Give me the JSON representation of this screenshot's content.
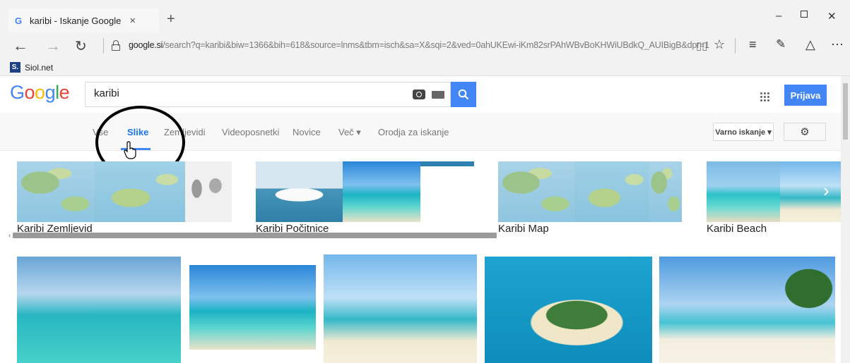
{
  "browser": {
    "tab_title": "karibi - Iskanje Google",
    "tab_close": "×",
    "new_tab": "+",
    "url_host": "google.si",
    "url_rest": "/search?q=karibi&biw=1366&bih=618&source=lnms&tbm=isch&sa=X&sqi=2&ved=0ahUKEwi-iKm82srPAhWBvBoKHWiUBdkQ_AUIBigB&dpr=1",
    "favorites": [
      {
        "label": "Siol.net",
        "icon_text": "S."
      }
    ]
  },
  "google": {
    "logo_letters": [
      {
        "ch": "G",
        "color": "#4285f4"
      },
      {
        "ch": "o",
        "color": "#ea4335"
      },
      {
        "ch": "o",
        "color": "#fbbc05"
      },
      {
        "ch": "g",
        "color": "#4285f4"
      },
      {
        "ch": "l",
        "color": "#34a853"
      },
      {
        "ch": "e",
        "color": "#ea4335"
      }
    ],
    "search_value": "karibi",
    "signin_label": "Prijava",
    "nav": {
      "items": [
        "Vse",
        "Slike",
        "Zemljevidi",
        "Videoposnetki",
        "Novice",
        "Več ▾",
        "Orodja za iskanje"
      ],
      "active": "Slike",
      "safe_search": "Varno iskanje ▾"
    },
    "related": [
      {
        "label": "Karibi Zemljevid"
      },
      {
        "label": "Karibi Počitnice"
      },
      {
        "label": "Karibi Map"
      },
      {
        "label": "Karibi Beach"
      }
    ],
    "results_count_visible": 5
  },
  "colors": {
    "accent": "#4285f4",
    "chrome_bg": "#f2f2f2",
    "annotation": "#000000"
  }
}
